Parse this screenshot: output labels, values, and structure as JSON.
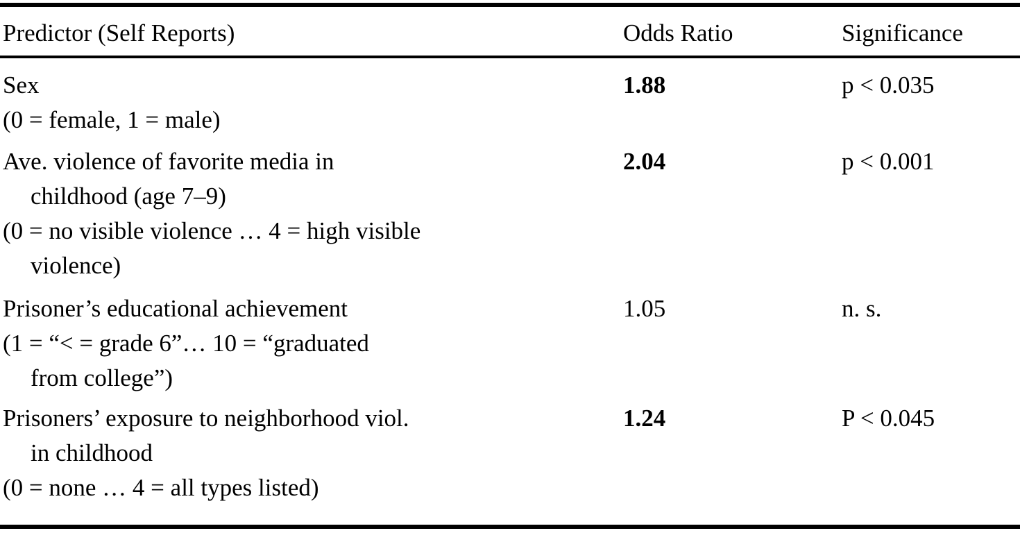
{
  "table": {
    "columns": [
      {
        "key": "predictor",
        "label": "Predictor (Self Reports)"
      },
      {
        "key": "odds_ratio",
        "label": "Odds Ratio"
      },
      {
        "key": "significance",
        "label": "Significance"
      }
    ],
    "rows": [
      {
        "predictor_lines": [
          {
            "text": "Sex",
            "indent": false
          },
          {
            "text": "(0 = female, 1 = male)",
            "indent": false
          }
        ],
        "odds_ratio": "1.88",
        "odds_ratio_bold": true,
        "significance": "p < 0.035"
      },
      {
        "predictor_lines": [
          {
            "text": "Ave. violence of favorite media in",
            "indent": false
          },
          {
            "text": "childhood (age 7–9)",
            "indent": true
          },
          {
            "text": "(0 = no visible violence … 4 = high visible",
            "indent": false
          },
          {
            "text": "violence)",
            "indent": true
          }
        ],
        "odds_ratio": "2.04",
        "odds_ratio_bold": true,
        "significance": "p < 0.001"
      },
      {
        "predictor_lines": [
          {
            "text": "Prisoner’s educational achievement",
            "indent": false
          },
          {
            "text": "(1 = “< = grade 6”… 10 = “graduated",
            "indent": false
          },
          {
            "text": "from college”)",
            "indent": true
          }
        ],
        "odds_ratio": "1.05",
        "odds_ratio_bold": false,
        "significance": "n. s."
      },
      {
        "predictor_lines": [
          {
            "text": "Prisoners’ exposure to neighborhood viol.",
            "indent": false
          },
          {
            "text": "in childhood",
            "indent": true
          },
          {
            "text": "(0 = none … 4 = all types listed)",
            "indent": false
          }
        ],
        "odds_ratio": "1.24",
        "odds_ratio_bold": true,
        "significance": "P < 0.045"
      }
    ]
  }
}
